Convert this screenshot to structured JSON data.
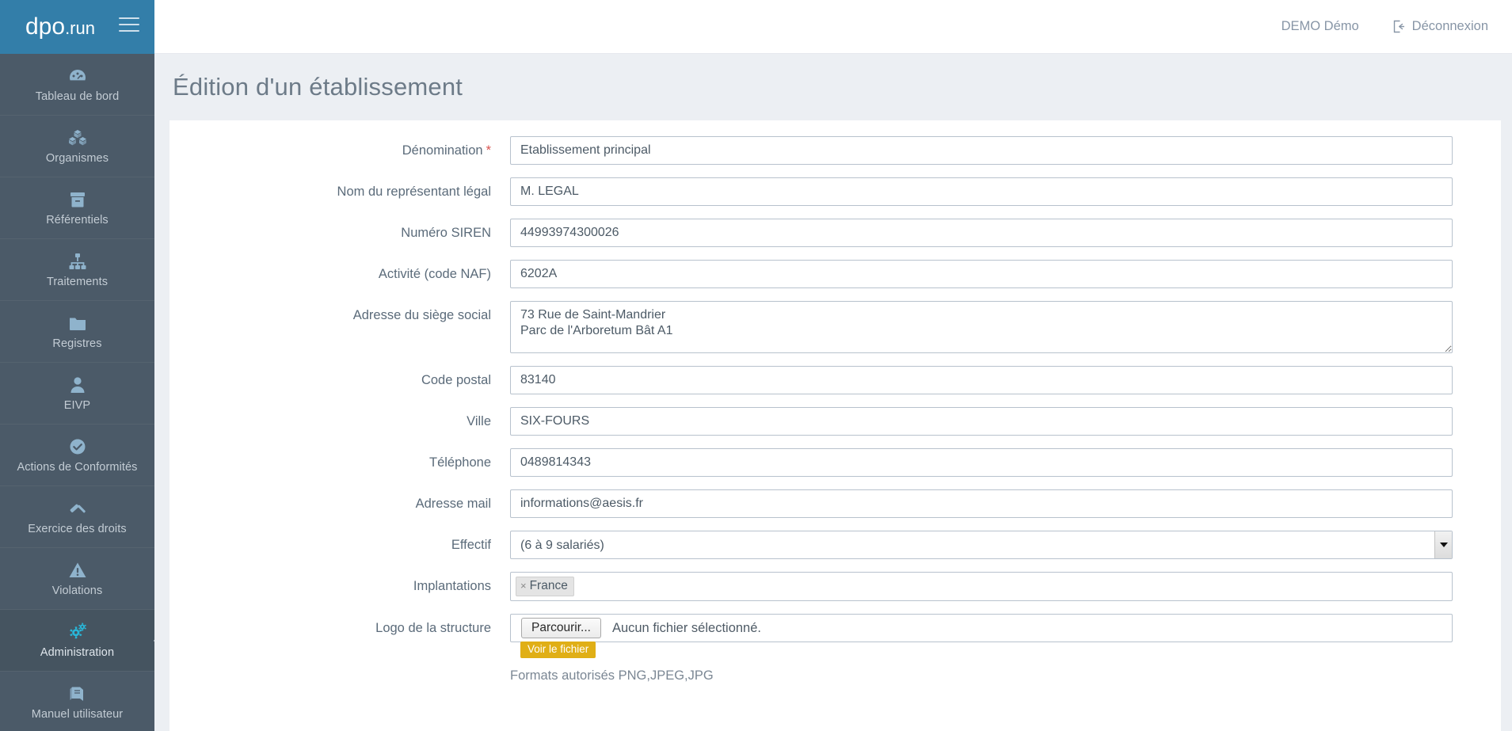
{
  "brand": {
    "logo_main": "dpo",
    "logo_suffix": ".run",
    "menu_icon": "hamburger-icon"
  },
  "topbar": {
    "user_name": "DEMO Démo",
    "logout_label": "Déconnexion",
    "logout_icon": "sign-out-icon"
  },
  "sidebar": {
    "items": [
      {
        "label": "Tableau de bord",
        "icon": "dashboard-gauge-icon",
        "active": false
      },
      {
        "label": "Organismes",
        "icon": "cubes-icon",
        "active": false
      },
      {
        "label": "Référentiels",
        "icon": "archive-box-icon",
        "active": false
      },
      {
        "label": "Traitements",
        "icon": "sitemap-icon",
        "active": false
      },
      {
        "label": "Registres",
        "icon": "folder-icon",
        "active": false
      },
      {
        "label": "EIVP",
        "icon": "user-icon",
        "active": false
      },
      {
        "label": "Actions de Conformités",
        "icon": "check-circle-icon",
        "active": false
      },
      {
        "label": "Exercice des droits",
        "icon": "gavel-icon",
        "active": false
      },
      {
        "label": "Violations",
        "icon": "warning-triangle-icon",
        "active": false
      },
      {
        "label": "Administration",
        "icon": "gears-icon",
        "active": true
      },
      {
        "label": "Manuel utilisateur",
        "icon": "book-icon",
        "active": false
      }
    ]
  },
  "page": {
    "title": "Édition d'un établissement"
  },
  "form": {
    "fields": [
      {
        "name": "denomination",
        "label": "Dénomination",
        "required": true,
        "required_mark": "*",
        "type": "text",
        "value": "Etablissement principal"
      },
      {
        "name": "representant-legal",
        "label": "Nom du représentant légal",
        "required": false,
        "type": "text",
        "value": "M. LEGAL"
      },
      {
        "name": "numero-siren",
        "label": "Numéro SIREN",
        "required": false,
        "type": "text",
        "value": "44993974300026"
      },
      {
        "name": "code-naf",
        "label": "Activité (code NAF)",
        "required": false,
        "type": "text",
        "value": "6202A"
      },
      {
        "name": "adresse-siege-social",
        "label": "Adresse du siège social",
        "required": false,
        "type": "textarea",
        "value": "73 Rue de Saint-Mandrier\nParc de l'Arboretum Bât A1"
      },
      {
        "name": "code-postal",
        "label": "Code postal",
        "required": false,
        "type": "text",
        "value": "83140"
      },
      {
        "name": "ville",
        "label": "Ville",
        "required": false,
        "type": "text",
        "value": "SIX-FOURS"
      },
      {
        "name": "telephone",
        "label": "Téléphone",
        "required": false,
        "type": "text",
        "value": "0489814343"
      },
      {
        "name": "adresse-mail",
        "label": "Adresse mail",
        "required": false,
        "type": "text",
        "value": "informations@aesis.fr"
      }
    ],
    "effectif": {
      "label": "Effectif",
      "selected": "(6 à 9 salariés)"
    },
    "implantations": {
      "label": "Implantations",
      "tags": [
        {
          "label": "France",
          "remove_icon": "×"
        }
      ]
    },
    "logo": {
      "label": "Logo de la structure",
      "browse_label": "Parcourir...",
      "file_status": "Aucun fichier sélectionné.",
      "view_file_label": "Voir le fichier",
      "formats_note": "Formats autorisés PNG,JPEG,JPG"
    }
  },
  "colors": {
    "brand_blue": "#337ea9",
    "sidebar": "#4b5a68",
    "sidebar_active": "#455460",
    "page_bg": "#eceff3",
    "accent_cyan": "#29b6d8",
    "required_red": "#d9534f",
    "warning_yellow": "#e0af16"
  }
}
